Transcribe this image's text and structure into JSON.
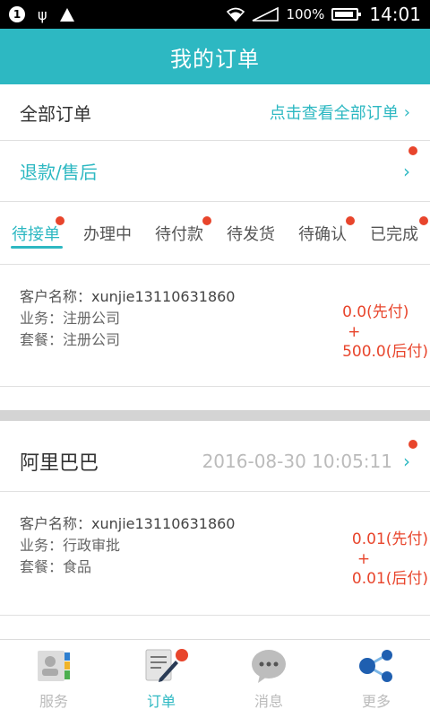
{
  "status_bar": {
    "notification_count": "1",
    "battery_percent": "100%",
    "time": "14:01"
  },
  "header": {
    "title": "我的订单"
  },
  "all_orders": {
    "label": "全部订单",
    "link": "点击查看全部订单"
  },
  "refund": {
    "label": "退款/售后"
  },
  "tabs": [
    {
      "label": "待接单",
      "active": true,
      "dot": true
    },
    {
      "label": "办理中",
      "active": false,
      "dot": false
    },
    {
      "label": "待付款",
      "active": false,
      "dot": true
    },
    {
      "label": "待发货",
      "active": false,
      "dot": false
    },
    {
      "label": "待确认",
      "active": false,
      "dot": true
    },
    {
      "label": "已完成",
      "active": false,
      "dot": true
    }
  ],
  "orders": [
    {
      "customer_label": "客户名称：",
      "customer": "xunjie13110631860",
      "business_label": "业务：",
      "business": "注册公司",
      "package_label": "套餐：",
      "package": "注册公司",
      "price_pre": "0.0(先付)",
      "plus": "+",
      "price_post": "500.0(后付)"
    },
    {
      "shop_name": "阿里巴巴",
      "date": "2016-08-30 10:05:11",
      "customer_label": "客户名称：",
      "customer": "xunjie13110631860",
      "business_label": "业务：",
      "business": "行政审批",
      "package_label": "套餐：",
      "package": "食品",
      "price_pre": "0.01(先付)",
      "plus": "+",
      "price_post": "0.01(后付)"
    }
  ],
  "bottom_nav": [
    {
      "label": "服务",
      "icon": "contacts-icon"
    },
    {
      "label": "订单",
      "icon": "order-edit-icon",
      "active": true
    },
    {
      "label": "消息",
      "icon": "chat-bubble-icon"
    },
    {
      "label": "更多",
      "icon": "share-icon"
    }
  ],
  "colors": {
    "accent": "#2db8c2",
    "price": "#e8452c",
    "badge": "#e8452c"
  }
}
